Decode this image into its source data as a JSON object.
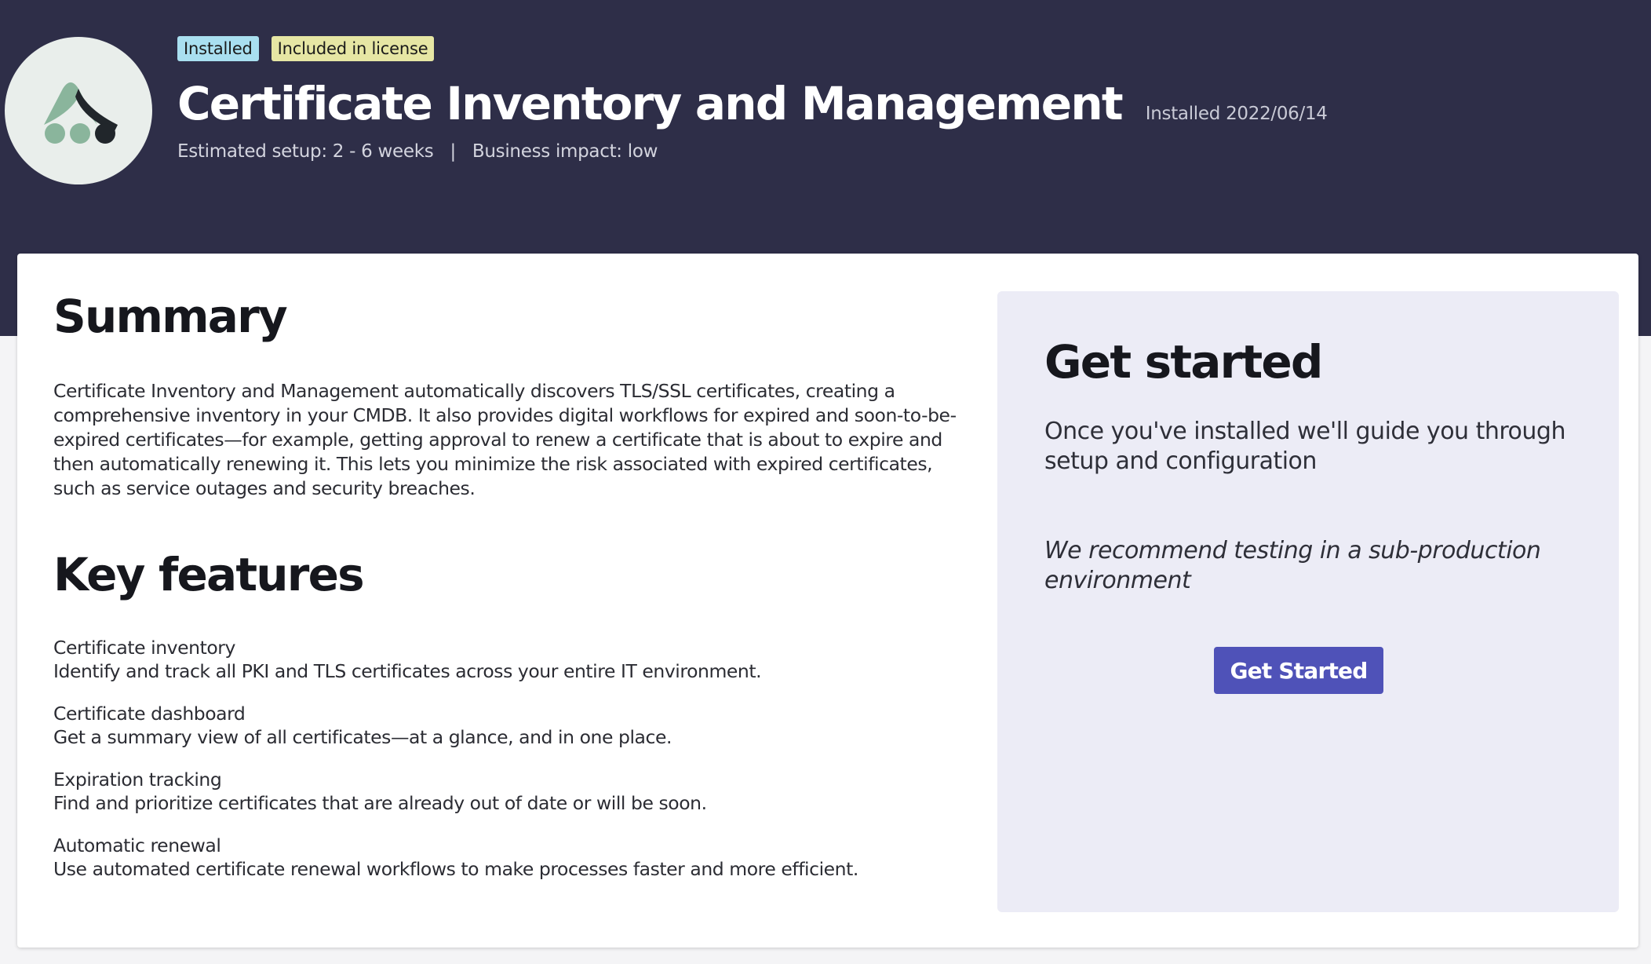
{
  "header": {
    "logo_icon": "app-logo-icon",
    "badges": {
      "installed": "Installed",
      "license": "Included in license"
    },
    "title": "Certificate Inventory and Management",
    "installed_date": "Installed 2022/06/14",
    "setup_label": "Estimated setup:",
    "setup_value": "2 - 6 weeks",
    "separator": "|",
    "impact_label": "Business impact:",
    "impact_value": "low"
  },
  "summary": {
    "heading": "Summary",
    "text": "Certificate Inventory and Management automatically discovers TLS/SSL certificates, creating a comprehensive inventory in your CMDB. It also provides digital workflows for expired and soon-to-be-expired certificates—for example, getting approval to renew a certificate that is about to expire and then automatically renewing it. This lets you minimize the risk associated with expired certificates, such as service outages and security breaches."
  },
  "key_features": {
    "heading": "Key features",
    "items": [
      {
        "title": "Certificate inventory",
        "description": "Identify and track all PKI and TLS certificates across your entire IT environment."
      },
      {
        "title": "Certificate dashboard",
        "description": "Get a summary view of all certificates—at a glance, and in one place."
      },
      {
        "title": "Expiration tracking",
        "description": "Find and prioritize certificates that are already out of date or will be soon."
      },
      {
        "title": "Automatic renewal",
        "description": "Use automated certificate renewal workflows to make processes faster and more efficient."
      }
    ]
  },
  "get_started": {
    "heading": "Get started",
    "text": "Once you've installed we'll guide you through setup and configuration",
    "note": "We recommend testing in a sub-production environment",
    "button_label": "Get Started"
  },
  "colors": {
    "hero_background": "#2e2e48",
    "badge_installed": "#a9dff0",
    "badge_license": "#e6e6a4",
    "panel_background": "#ececf6",
    "button_primary": "#4f52b8"
  }
}
